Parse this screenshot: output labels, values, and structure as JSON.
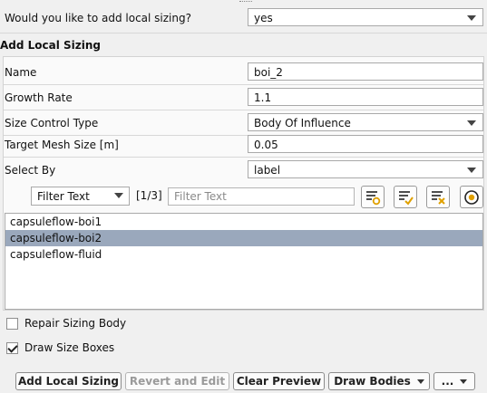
{
  "question": {
    "label": "Would you like to add local sizing?",
    "value": "yes"
  },
  "section_heading": "Add Local Sizing",
  "fields": {
    "name": {
      "label": "Name",
      "value": "boi_2"
    },
    "growth_rate": {
      "label": "Growth Rate",
      "value": "1.1"
    },
    "size_control_type": {
      "label": "Size Control Type",
      "value": "Body Of Influence"
    },
    "target_mesh_size": {
      "label": "Target Mesh Size [m]",
      "value": "0.05"
    },
    "select_by": {
      "label": "Select By",
      "value": "label"
    }
  },
  "filter": {
    "mode": "Filter Text",
    "counter": "[1/3]",
    "placeholder": "Filter Text",
    "icons": [
      "filter-select-icon",
      "select-all-icon",
      "deselect-all-icon",
      "use-selection-icon"
    ]
  },
  "list": {
    "items": [
      "capsuleflow-boi1",
      "capsuleflow-boi2",
      "capsuleflow-fluid"
    ],
    "selected_index": 1
  },
  "options": {
    "repair": {
      "label": "Repair Sizing Body",
      "checked": false
    },
    "draw_boxes": {
      "label": "Draw Size Boxes",
      "checked": true
    }
  },
  "buttons": {
    "add": "Add Local Sizing",
    "revert": "Revert and Edit",
    "clear": "Clear Preview",
    "draw": "Draw Bodies",
    "more": "..."
  },
  "colors": {
    "selection": "#9aa8bc",
    "panel_border": "#d3d3d3"
  }
}
